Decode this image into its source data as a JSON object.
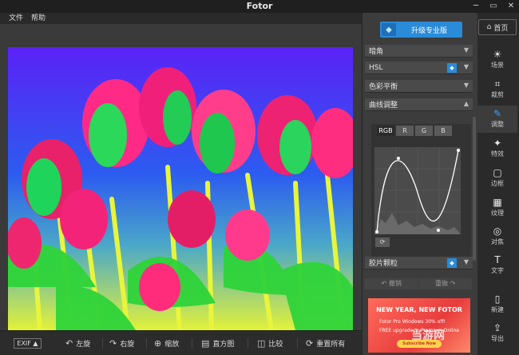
{
  "app": {
    "title": "Fotor"
  },
  "window_buttons": {
    "minimize": "─",
    "maximize": "▭",
    "close": "✕"
  },
  "menu": {
    "items": [
      "文件",
      "帮助"
    ]
  },
  "upgrade": {
    "label": "升级专业版"
  },
  "home": {
    "label": "首页"
  },
  "sections": [
    {
      "label": "暗角",
      "badge": false
    },
    {
      "label": "HSL",
      "badge": true
    },
    {
      "label": "色彩平衡",
      "badge": false
    },
    {
      "label": "曲线调整",
      "badge": false
    },
    {
      "label": "胶片颗粒",
      "badge": true
    }
  ],
  "curves": {
    "channels": [
      "RGB",
      "R",
      "G",
      "B"
    ],
    "active_channel": "RGB"
  },
  "history": {
    "undo": "撤销",
    "redo": "重做"
  },
  "ad": {
    "title": "NEW YEAR, NEW FOTOR",
    "line1": "Fotor Pro Windows 30% off!",
    "line2": "FREE upgrade to Premium Online",
    "button": "Subscribe Now",
    "watermark": "当游网"
  },
  "nav": [
    {
      "icon": "sun-icon",
      "glyph": "☀",
      "label": "场景"
    },
    {
      "icon": "crop-icon",
      "glyph": "⌗",
      "label": "裁剪"
    },
    {
      "icon": "pencil-icon",
      "glyph": "✎",
      "label": "调整",
      "active": true
    },
    {
      "icon": "sparkle-icon",
      "glyph": "✦",
      "label": "特效"
    },
    {
      "icon": "frame-icon",
      "glyph": "▢",
      "label": "边框"
    },
    {
      "icon": "texture-icon",
      "glyph": "▦",
      "label": "纹理"
    },
    {
      "icon": "focus-icon",
      "glyph": "◎",
      "label": "对焦"
    },
    {
      "icon": "text-icon",
      "glyph": "T",
      "label": "文字"
    },
    {
      "icon": "new-file-icon",
      "glyph": "▯",
      "label": "新建"
    },
    {
      "icon": "export-icon",
      "glyph": "⇪",
      "label": "导出"
    }
  ],
  "bottom": {
    "exif": "EXIF ▲",
    "tools": [
      {
        "icon": "rotate-left-icon",
        "glyph": "↶",
        "label": "左旋"
      },
      {
        "icon": "rotate-right-icon",
        "glyph": "↷",
        "label": "右旋"
      },
      {
        "icon": "zoom-icon",
        "glyph": "⊕",
        "label": "缩放"
      },
      {
        "icon": "histogram-icon",
        "glyph": "▤",
        "label": "直方图"
      },
      {
        "icon": "compare-icon",
        "glyph": "◫",
        "label": "比较"
      },
      {
        "icon": "reset-all-icon",
        "glyph": "⟳",
        "label": "重置所有"
      }
    ]
  }
}
